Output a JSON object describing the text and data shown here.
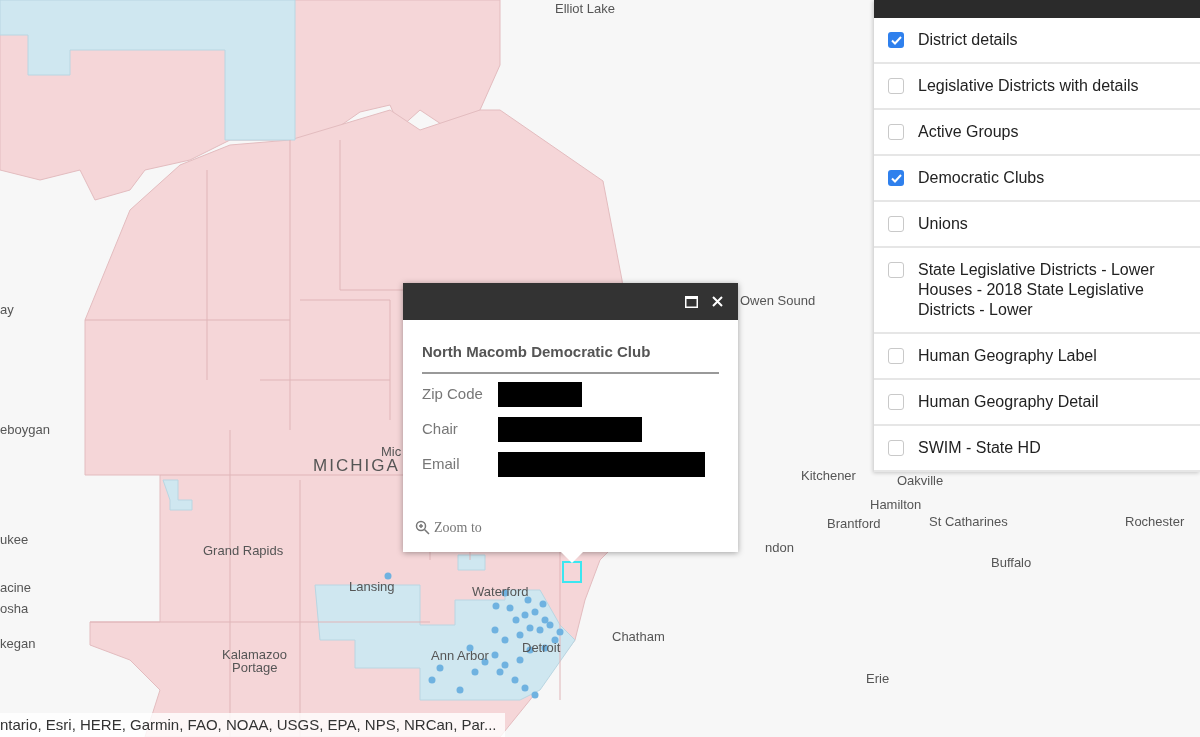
{
  "map_labels": [
    "Elliot Lake",
    "Owen Sound",
    "ay",
    "eboygan",
    "Mic",
    "MICHIGA",
    "Kitchener",
    "Oakville",
    "Hamilton",
    "ukee",
    "Grand Rapids",
    "Brantford",
    "St Catharines",
    "Rochester",
    "ndon",
    "Buffalo",
    "acine",
    "Lansing",
    "Waterford",
    "osha",
    "Chatham",
    "kegan",
    "Detroit",
    "Ann Arbor",
    "Kalamazoo",
    "Portage",
    "Erie"
  ],
  "attribution": "ntario, Esri, HERE, Garmin, FAO, NOAA, USGS, EPA, NPS, NRCan, Par...",
  "popup": {
    "title": "North Macomb Democratic Club",
    "fields": [
      {
        "label": "Zip Code"
      },
      {
        "label": "Chair"
      },
      {
        "label": "Email"
      }
    ],
    "zoom_link": "Zoom to"
  },
  "layers": [
    {
      "label": "District details",
      "checked": true
    },
    {
      "label": "Legislative Districts with details",
      "checked": false
    },
    {
      "label": "Active Groups",
      "checked": false
    },
    {
      "label": "Democratic Clubs",
      "checked": true
    },
    {
      "label": "Unions",
      "checked": false
    },
    {
      "label": "State Legislative Districts - Lower Houses - 2018 State Legislative Districts - Lower",
      "checked": false
    },
    {
      "label": "Human Geography Label",
      "checked": false
    },
    {
      "label": "Human Geography Detail",
      "checked": false
    },
    {
      "label": "SWIM - State HD",
      "checked": false
    }
  ]
}
